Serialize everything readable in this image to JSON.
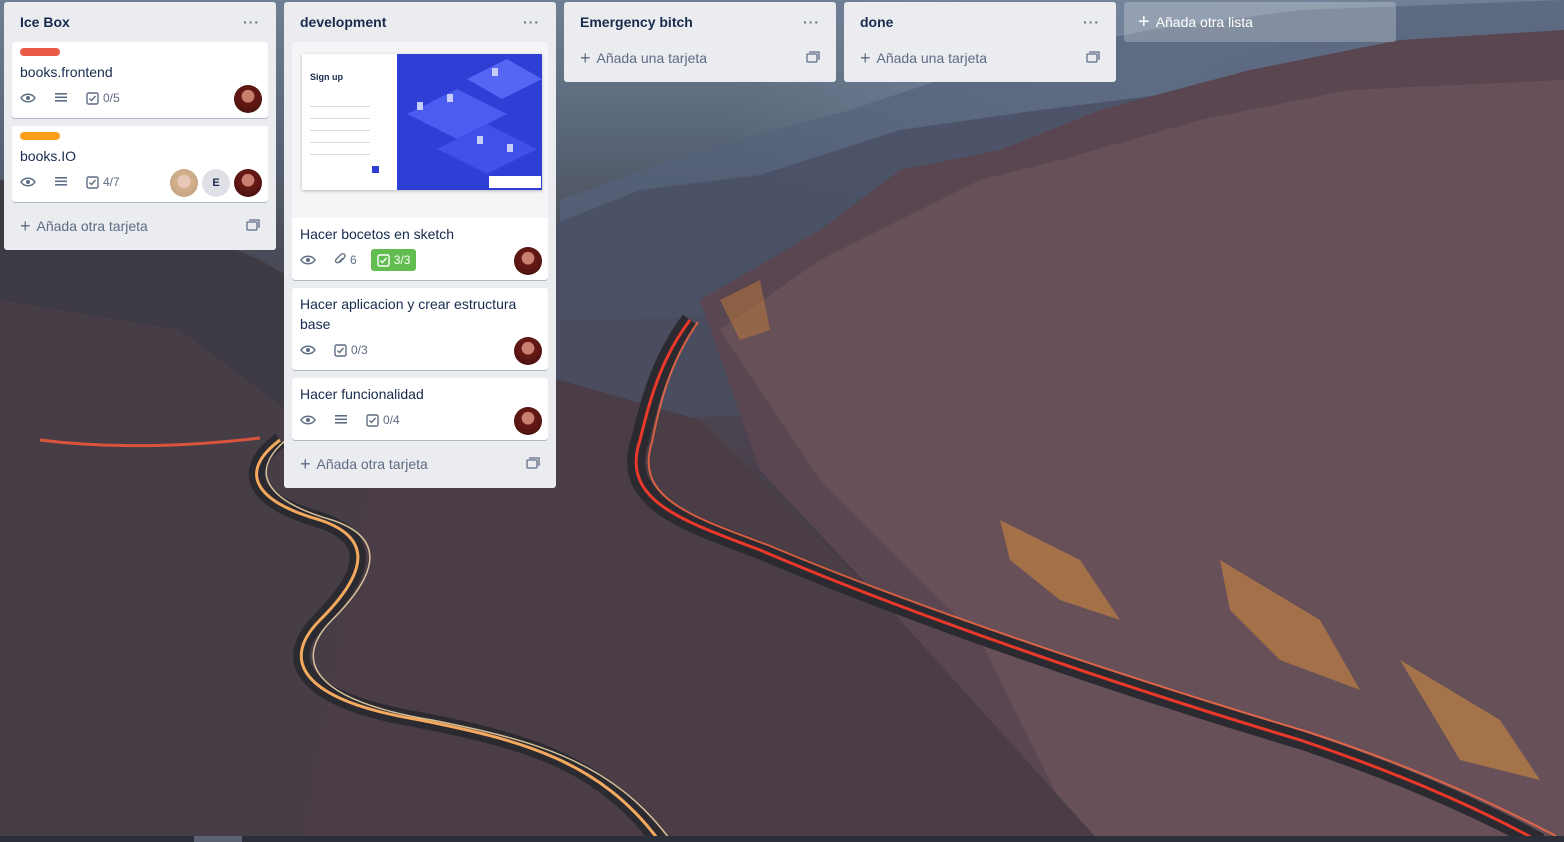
{
  "board": {
    "lists": [
      {
        "title": "Ice Box",
        "menu": "···",
        "cards": [
          {
            "label_color": "#eb5a46",
            "title": "books.frontend",
            "checklist": "0/5"
          },
          {
            "label_color": "#ff9f1a",
            "title": "books.IO",
            "checklist": "4/7",
            "member_initial": "E"
          }
        ],
        "add_card": "Añada otra tarjeta"
      },
      {
        "title": "development",
        "menu": "···",
        "cover": {
          "title": "Sign up"
        },
        "cards": [
          {
            "title": "Hacer bocetos en sketch",
            "attachments": "6",
            "checklist": "3/3"
          },
          {
            "title": "Hacer aplicacion y crear estructura base",
            "checklist": "0/3"
          },
          {
            "title": "Hacer funcionalidad",
            "checklist": "0/4"
          }
        ],
        "add_card": "Añada otra tarjeta"
      },
      {
        "title": "Emergency bitch",
        "menu": "···",
        "add_card": "Añada una tarjeta"
      },
      {
        "title": "done",
        "menu": "···",
        "add_card": "Añada una tarjeta"
      }
    ],
    "add_list": "Añada otra lista"
  },
  "colors": {
    "list_bg": "#ebecf0",
    "checklist_complete": "#61bd4f",
    "label_red": "#eb5a46",
    "label_orange": "#ff9f1a"
  },
  "icons": [
    "eye-icon",
    "description-icon",
    "checklist-icon",
    "attachment-icon",
    "plus-icon",
    "card-template-icon",
    "list-menu-icon"
  ]
}
